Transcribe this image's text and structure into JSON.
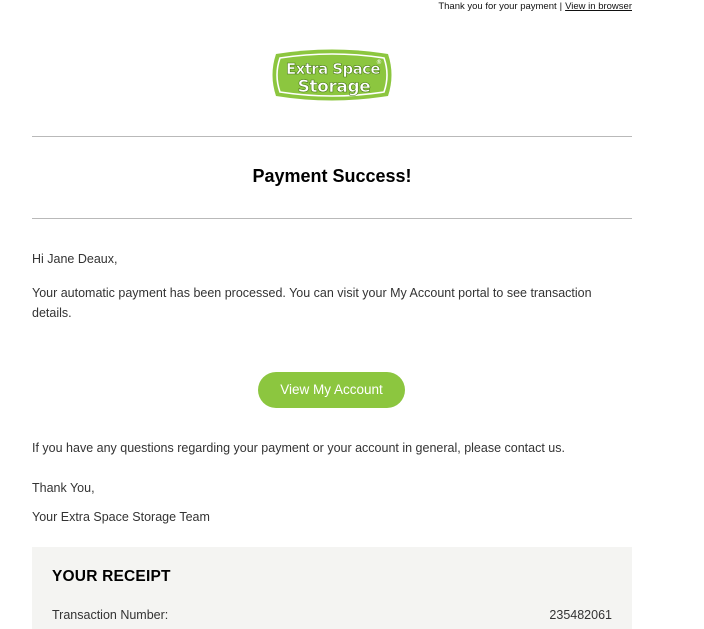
{
  "preheader": {
    "thanks_text": "Thank you for your payment",
    "separator": "|",
    "view_in_browser": "View in browser"
  },
  "logo": {
    "line1": "Extra Space",
    "line2": "Storage",
    "registered_mark": "®",
    "brand_green": "#8cc63f"
  },
  "headline": "Payment Success!",
  "message": {
    "greeting": "Hi Jane Deaux,",
    "body": "Your automatic payment has been processed. You can visit your My Account portal to see transaction details.",
    "button_label": "View My Account",
    "questions": "If you have any questions regarding your payment or your account in general, please contact us.",
    "thanks": "Thank You,",
    "signature": "Your Extra Space Storage Team"
  },
  "receipt": {
    "title": "YOUR RECEIPT",
    "rows": [
      {
        "label": "Transaction Number:",
        "value": "235482061"
      }
    ]
  },
  "colors": {
    "accent_green": "#8cc63f",
    "divider": "#b9b9b9",
    "receipt_bg": "#f4f4f2"
  }
}
